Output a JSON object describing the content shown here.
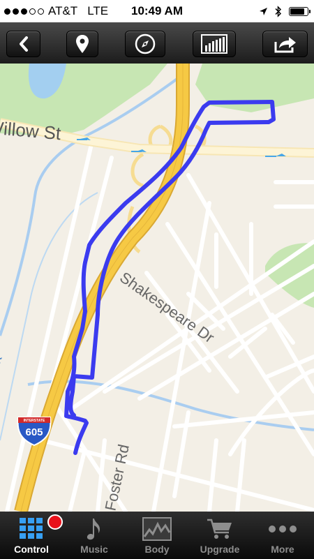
{
  "status": {
    "carrier": "AT&T",
    "network": "LTE",
    "time": "10:49 AM"
  },
  "toolbar": {
    "buttons": [
      {
        "name": "back",
        "icon": "chevron-left-icon"
      },
      {
        "name": "location",
        "icon": "map-pin-icon"
      },
      {
        "name": "compass",
        "icon": "compass-icon"
      },
      {
        "name": "stats",
        "icon": "bar-chart-icon"
      },
      {
        "name": "share",
        "icon": "share-arrow-icon"
      }
    ]
  },
  "map": {
    "labels": {
      "willow": "Willow St",
      "shakespeare": "Shakespeare Dr",
      "foster": "Foster Rd",
      "creek": "eek",
      "shield_top": "INTERSTATE",
      "shield_number": "605"
    },
    "route_color": "#3b3bef",
    "highway_color": "#f5c642"
  },
  "tabbar": {
    "tabs": [
      {
        "label": "Control",
        "icon": "grid-icon",
        "active": true,
        "recording": true
      },
      {
        "label": "Music",
        "icon": "music-note-icon",
        "active": false
      },
      {
        "label": "Body",
        "icon": "activity-graph-icon",
        "active": false
      },
      {
        "label": "Upgrade",
        "icon": "cart-icon",
        "active": false
      },
      {
        "label": "More",
        "icon": "more-dots-icon",
        "active": false
      }
    ]
  }
}
